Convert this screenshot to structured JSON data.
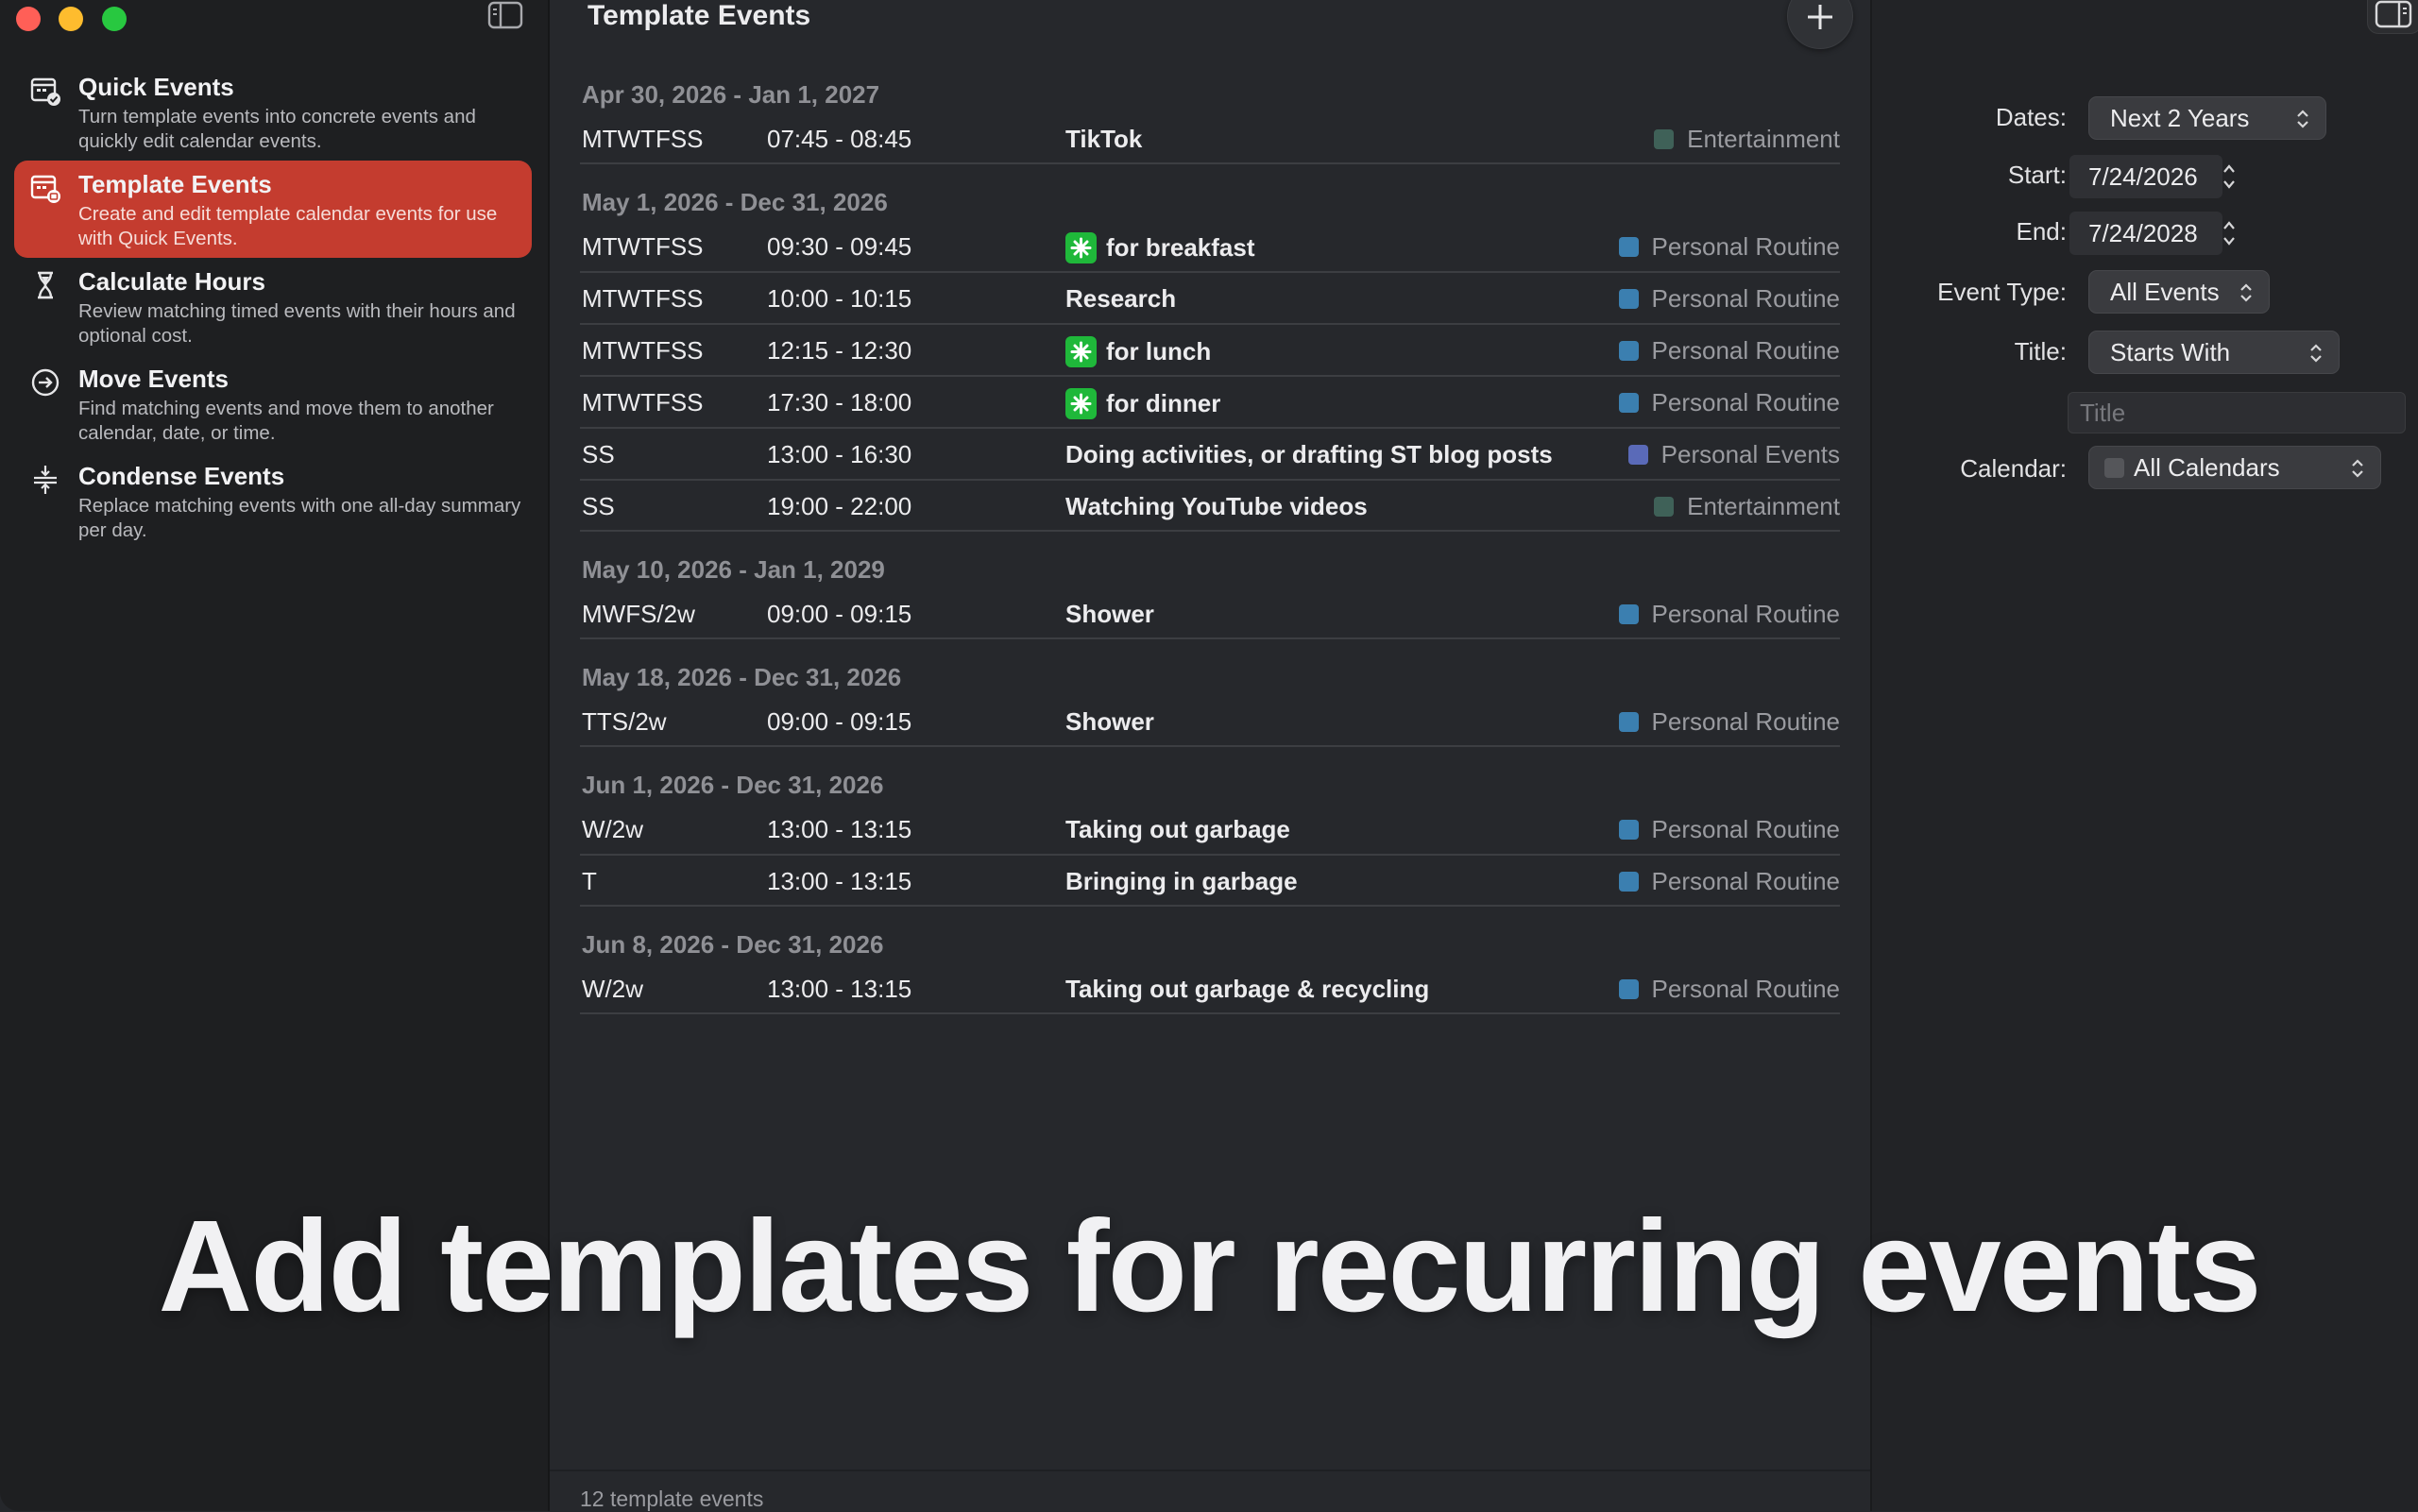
{
  "sidebar": {
    "items": [
      {
        "title": "Quick Events",
        "desc": "Turn template events into concrete events and quickly edit calendar events.",
        "icon": "calendar-check-icon"
      },
      {
        "title": "Template Events",
        "desc": "Create and edit template calendar events for use with Quick Events.",
        "icon": "calendar-template-icon"
      },
      {
        "title": "Calculate Hours",
        "desc": "Review matching timed events with their hours and optional cost.",
        "icon": "hourglass-icon"
      },
      {
        "title": "Move Events",
        "desc": "Find matching events and move them to another calendar, date, or time.",
        "icon": "arrow-circle-icon"
      },
      {
        "title": "Condense Events",
        "desc": "Replace matching events with one all-day summary per day.",
        "icon": "condense-icon"
      }
    ],
    "active_index": 1
  },
  "main": {
    "title": "Template Events",
    "footer": "12 template events",
    "groups": [
      {
        "range": "Apr 30, 2026 - Jan 1, 2027",
        "rows": [
          {
            "days": "MTWTFSS",
            "time": "07:45 - 08:45",
            "title": "TikTok",
            "emoji": false,
            "calendar": "Entertainment",
            "color": "#3f6158"
          }
        ]
      },
      {
        "range": "May 1, 2026 - Dec 31, 2026",
        "rows": [
          {
            "days": "MTWTFSS",
            "time": "09:30 - 09:45",
            "title": "for breakfast",
            "emoji": true,
            "calendar": "Personal Routine",
            "color": "#3b7fb0"
          },
          {
            "days": "MTWTFSS",
            "time": "10:00 - 10:15",
            "title": "Research",
            "emoji": false,
            "calendar": "Personal Routine",
            "color": "#3b7fb0"
          },
          {
            "days": "MTWTFSS",
            "time": "12:15 - 12:30",
            "title": "for lunch",
            "emoji": true,
            "calendar": "Personal Routine",
            "color": "#3b7fb0"
          },
          {
            "days": "MTWTFSS",
            "time": "17:30 - 18:00",
            "title": "for dinner",
            "emoji": true,
            "calendar": "Personal Routine",
            "color": "#3b7fb0"
          },
          {
            "days": "SS",
            "time": "13:00 - 16:30",
            "title": "Doing activities, or drafting ST blog posts",
            "emoji": false,
            "calendar": "Personal Events",
            "color": "#5a6ab8"
          },
          {
            "days": "SS",
            "time": "19:00 - 22:00",
            "title": "Watching YouTube videos",
            "emoji": false,
            "calendar": "Entertainment",
            "color": "#3f6158"
          }
        ]
      },
      {
        "range": "May 10, 2026 - Jan 1, 2029",
        "rows": [
          {
            "days": "MWFS/2w",
            "time": "09:00 - 09:15",
            "title": "Shower",
            "emoji": false,
            "calendar": "Personal Routine",
            "color": "#3b7fb0"
          }
        ]
      },
      {
        "range": "May 18, 2026 - Dec 31, 2026",
        "rows": [
          {
            "days": "TTS/2w",
            "time": "09:00 - 09:15",
            "title": "Shower",
            "emoji": false,
            "calendar": "Personal Routine",
            "color": "#3b7fb0"
          }
        ]
      },
      {
        "range": "Jun 1, 2026 - Dec 31, 2026",
        "rows": [
          {
            "days": "W/2w",
            "time": "13:00 - 13:15",
            "title": "Taking out garbage",
            "emoji": false,
            "calendar": "Personal Routine",
            "color": "#3b7fb0"
          },
          {
            "days": "T",
            "time": "13:00 - 13:15",
            "title": "Bringing in garbage",
            "emoji": false,
            "calendar": "Personal Routine",
            "color": "#3b7fb0"
          }
        ]
      },
      {
        "range": "Jun 8, 2026 - Dec 31, 2026",
        "rows": [
          {
            "days": "W/2w",
            "time": "13:00 - 13:15",
            "title": "Taking out garbage & recycling",
            "emoji": false,
            "calendar": "Personal Routine",
            "color": "#3b7fb0"
          }
        ]
      }
    ]
  },
  "inspector": {
    "dates_label": "Dates:",
    "dates_value": "Next 2 Years",
    "start_label": "Start:",
    "start_value": "7/24/2026",
    "end_label": "End:",
    "end_value": "7/24/2028",
    "event_type_label": "Event Type:",
    "event_type_value": "All Events",
    "title_label": "Title:",
    "title_mode": "Starts With",
    "title_placeholder": "Title",
    "calendar_label": "Calendar:",
    "calendar_value": "All Calendars"
  },
  "caption": "Add templates for recurring events",
  "colors": {
    "accent": "#c43c2f",
    "emoji_green": "#1fb83a"
  }
}
